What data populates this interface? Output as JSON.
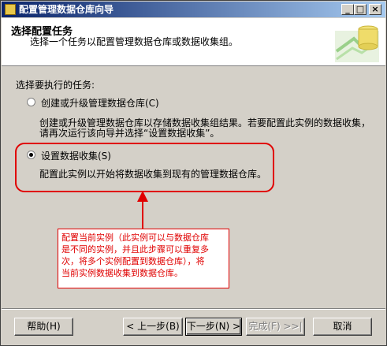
{
  "window": {
    "title": "配置管理数据仓库向导"
  },
  "header": {
    "title": "选择配置任务",
    "description": "选择一个任务以配置管理数据仓库或数据收集组。"
  },
  "main": {
    "prompt": "选择要执行的任务:",
    "options": [
      {
        "label": "创建或升级管理数据仓库(C)",
        "selected": false,
        "description_lines": [
          "创建或升级管理数据仓库以存储数据收集组结果。若要配置此实例的数据收集，",
          "请再次运行该向导并选择“设置数据收集”。"
        ]
      },
      {
        "label": "设置数据收集(S)",
        "selected": true,
        "description_lines": [
          "配置此实例以开始将数据收集到现有的管理数据仓库。"
        ]
      }
    ]
  },
  "annotation": {
    "color": "#e00000",
    "callout_lines": [
      "配置当前实例（此实例可以与数据仓库",
      "是不同的实例，并且此步骤可以重复多",
      "次，将多个实例配置到数据仓库），将",
      "当前实例数据收集到数据仓库。"
    ]
  },
  "footer": {
    "help": "帮助(H)",
    "back": "< 上一步(B)",
    "next": "下一步(N) >",
    "finish": "完成(F) >>|",
    "cancel": "取消"
  }
}
